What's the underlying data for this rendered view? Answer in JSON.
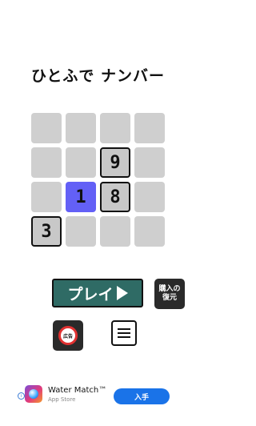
{
  "title": "ひとふで ナンバー",
  "grid": {
    "cells": [
      {
        "row": 0,
        "col": 0,
        "value": "",
        "state": "empty"
      },
      {
        "row": 0,
        "col": 1,
        "value": "",
        "state": "empty"
      },
      {
        "row": 0,
        "col": 2,
        "value": "",
        "state": "empty"
      },
      {
        "row": 0,
        "col": 3,
        "value": "",
        "state": "empty"
      },
      {
        "row": 1,
        "col": 0,
        "value": "",
        "state": "empty"
      },
      {
        "row": 1,
        "col": 1,
        "value": "",
        "state": "empty"
      },
      {
        "row": 1,
        "col": 2,
        "value": "9",
        "state": "framed"
      },
      {
        "row": 1,
        "col": 3,
        "value": "",
        "state": "empty"
      },
      {
        "row": 2,
        "col": 0,
        "value": "",
        "state": "empty"
      },
      {
        "row": 2,
        "col": 1,
        "value": "1",
        "state": "active"
      },
      {
        "row": 2,
        "col": 2,
        "value": "8",
        "state": "framed"
      },
      {
        "row": 2,
        "col": 3,
        "value": "",
        "state": "empty"
      },
      {
        "row": 3,
        "col": 0,
        "value": "3",
        "state": "framed"
      },
      {
        "row": 3,
        "col": 1,
        "value": "",
        "state": "empty"
      },
      {
        "row": 3,
        "col": 2,
        "value": "",
        "state": "empty"
      },
      {
        "row": 3,
        "col": 3,
        "value": "",
        "state": "empty"
      }
    ]
  },
  "buttons": {
    "play_label": "プレイ",
    "restore_line1": "購入の",
    "restore_line2": "復元",
    "ad_label": "広告"
  },
  "ad": {
    "app_name": "Water Match™",
    "store": "App Store",
    "install_label": "入手"
  },
  "colors": {
    "play": "#2f6b65",
    "active_cell": "#6360f6",
    "empty_cell": "#cfcfcf",
    "install": "#1a73e8"
  }
}
